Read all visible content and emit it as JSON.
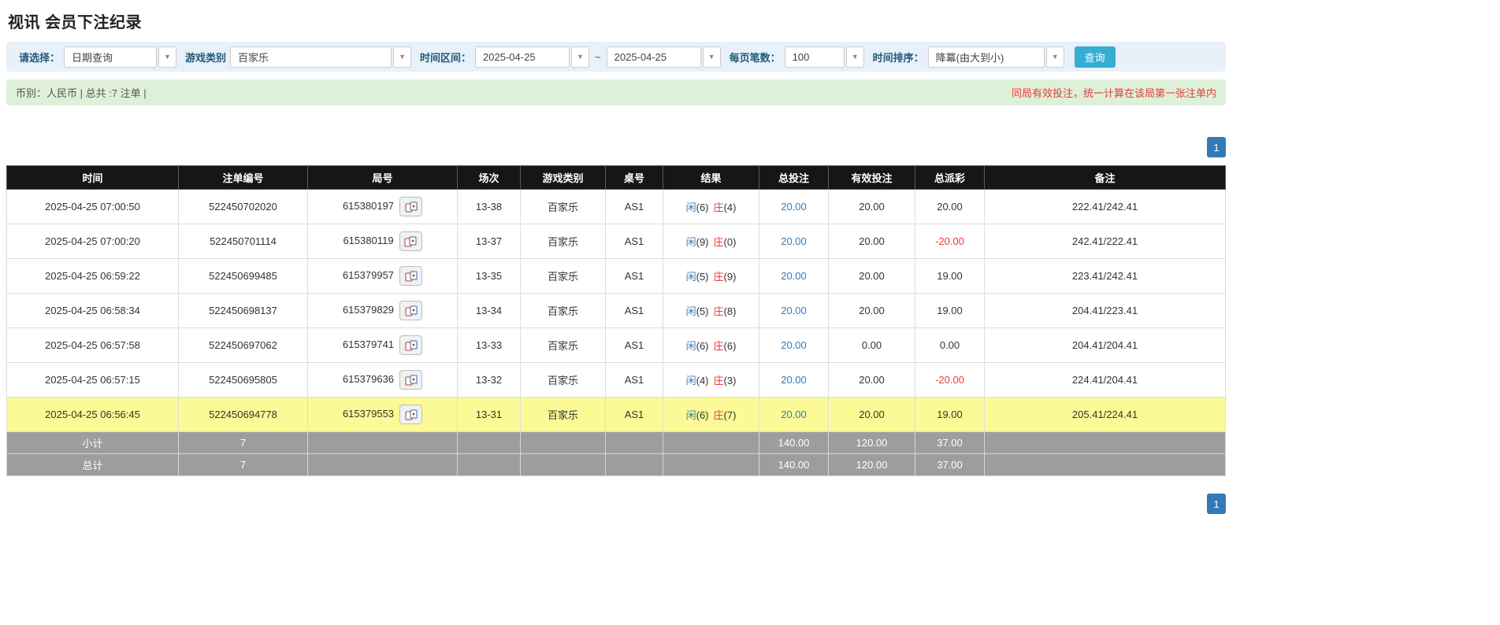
{
  "page": {
    "title": "视讯 会员下注纪录"
  },
  "colors": {
    "search_button": "#35aed3",
    "filter_bar_bg": "#e8f1f9",
    "summary_bar_bg": "#dff0d8",
    "table_header_bg": "#161616",
    "footer_row_bg": "#9d9d9d",
    "highlight_row": "#fbfa96",
    "link_blue": "#337ab7",
    "negative_red": "#e43b3b"
  },
  "filters": {
    "select_label": "请选择：",
    "select_value": "日期查询",
    "game_type_label": "游戏类别",
    "game_type_value": "百家乐",
    "time_range_label": "时间区间：",
    "time_from": "2025-04-25",
    "time_separator": "~",
    "time_to": "2025-04-25",
    "page_size_label": "每页笔数：",
    "page_size_value": "100",
    "sort_label": "时间排序：",
    "sort_value": "降冪(由大到小)",
    "search_button": "查询"
  },
  "summary": {
    "left": "币别：人民币 | 总共 :7 注单 |",
    "right": "同局有效投注，统一计算在该局第一张注单内"
  },
  "pagination": {
    "page": "1"
  },
  "table": {
    "headers": [
      "时间",
      "注单编号",
      "局号",
      "场次",
      "游戏类别",
      "桌号",
      "结果",
      "总投注",
      "有效投注",
      "总派彩",
      "备注"
    ],
    "rows": [
      {
        "time": "2025-04-25 07:00:50",
        "bet_id": "522450702020",
        "round_id": "615380197",
        "session": "13-38",
        "game": "百家乐",
        "table_no": "AS1",
        "result_player": "闲",
        "result_player_score": "(6)",
        "result_banker": "庄",
        "result_banker_score": "(4)",
        "total_bet": "20.00",
        "valid_bet": "20.00",
        "payout": "20.00",
        "note": "222.41/242.41",
        "highlight": false
      },
      {
        "time": "2025-04-25 07:00:20",
        "bet_id": "522450701114",
        "round_id": "615380119",
        "session": "13-37",
        "game": "百家乐",
        "table_no": "AS1",
        "result_player": "闲",
        "result_player_score": "(9)",
        "result_banker": "庄",
        "result_banker_score": "(0)",
        "total_bet": "20.00",
        "valid_bet": "20.00",
        "payout": "-20.00",
        "note": "242.41/222.41",
        "highlight": false
      },
      {
        "time": "2025-04-25 06:59:22",
        "bet_id": "522450699485",
        "round_id": "615379957",
        "session": "13-35",
        "game": "百家乐",
        "table_no": "AS1",
        "result_player": "闲",
        "result_player_score": "(5)",
        "result_banker": "庄",
        "result_banker_score": "(9)",
        "total_bet": "20.00",
        "valid_bet": "20.00",
        "payout": "19.00",
        "note": "223.41/242.41",
        "highlight": false
      },
      {
        "time": "2025-04-25 06:58:34",
        "bet_id": "522450698137",
        "round_id": "615379829",
        "session": "13-34",
        "game": "百家乐",
        "table_no": "AS1",
        "result_player": "闲",
        "result_player_score": "(5)",
        "result_banker": "庄",
        "result_banker_score": "(8)",
        "total_bet": "20.00",
        "valid_bet": "20.00",
        "payout": "19.00",
        "note": "204.41/223.41",
        "highlight": false
      },
      {
        "time": "2025-04-25 06:57:58",
        "bet_id": "522450697062",
        "round_id": "615379741",
        "session": "13-33",
        "game": "百家乐",
        "table_no": "AS1",
        "result_player": "闲",
        "result_player_score": "(6)",
        "result_banker": "庄",
        "result_banker_score": "(6)",
        "total_bet": "20.00",
        "valid_bet": "0.00",
        "payout": "0.00",
        "note": "204.41/204.41",
        "highlight": false
      },
      {
        "time": "2025-04-25 06:57:15",
        "bet_id": "522450695805",
        "round_id": "615379636",
        "session": "13-32",
        "game": "百家乐",
        "table_no": "AS1",
        "result_player": "闲",
        "result_player_score": "(4)",
        "result_banker": "庄",
        "result_banker_score": "(3)",
        "total_bet": "20.00",
        "valid_bet": "20.00",
        "payout": "-20.00",
        "note": "224.41/204.41",
        "highlight": false
      },
      {
        "time": "2025-04-25 06:56:45",
        "bet_id": "522450694778",
        "round_id": "615379553",
        "session": "13-31",
        "game": "百家乐",
        "table_no": "AS1",
        "result_player": "闲",
        "result_player_score": "(6)",
        "result_banker": "庄",
        "result_banker_score": "(7)",
        "total_bet": "20.00",
        "valid_bet": "20.00",
        "payout": "19.00",
        "note": "205.41/224.41",
        "highlight": true
      }
    ],
    "subtotal": {
      "label": "小计",
      "count": "7",
      "total_bet": "140.00",
      "valid_bet": "120.00",
      "payout": "37.00"
    },
    "total": {
      "label": "总计",
      "count": "7",
      "total_bet": "140.00",
      "valid_bet": "120.00",
      "payout": "37.00"
    }
  }
}
